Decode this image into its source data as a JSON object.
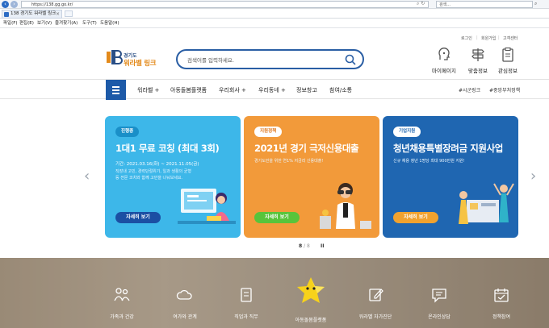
{
  "browser": {
    "url": "https://138.gg.go.kr/",
    "search_placeholder": "검색...",
    "tab_title": "138 경기도 워라벨 링크",
    "menu": [
      "파일(F)",
      "편집(E)",
      "보기(V)",
      "즐겨찾기(A)",
      "도구(T)",
      "도움말(H)"
    ]
  },
  "header": {
    "util_links": [
      "로그인",
      "회원가입",
      "고객센터"
    ],
    "logo_top": "경기도",
    "logo_bottom": "워라벨 링크",
    "search_placeholder": "검색어를 입력하세요.",
    "quick_links": [
      {
        "label": "마이페이지",
        "icon": "user-head-icon"
      },
      {
        "label": "맞춤정보",
        "icon": "signpost-icon"
      },
      {
        "label": "관심정보",
        "icon": "clipboard-icon"
      }
    ]
  },
  "gnb": {
    "items": [
      "워라벨",
      "아동돌봄플랫폼",
      "우리회사",
      "우리동네",
      "정보창고",
      "참여/소통"
    ],
    "tags": [
      "#시군링크",
      "#중앙부처정책"
    ]
  },
  "cards": [
    {
      "badge": "진행중",
      "title": "1대1 무료 코칭 (최대 3회)",
      "date": "기간: 2021.03.16(화) ~ 2021.11.05(금)",
      "desc": "직장내 고민, 경력단절위기, 일과 생활의 균형 등 전문 코치와 함께 고민을 나눠보세요.",
      "button": "자세히 보기",
      "color": "#3db7e9"
    },
    {
      "badge": "지원정책",
      "title": "2021년 경기 극저신용대출",
      "date": "",
      "desc": "경기도민을 위한 연1% 저금리 신용대출!",
      "button": "자세히 보기",
      "color": "#f29a3a"
    },
    {
      "badge": "기업지원",
      "title": "청년채용특별장려금 지원사업",
      "date": "",
      "desc": "신규 채용 청년 1명당 최대 900만원 지원!",
      "button": "자세히 보기",
      "color": "#1f66b1"
    }
  ],
  "pager": {
    "current": "8",
    "total": "/ 8",
    "pause": "II"
  },
  "services": [
    "가족과 건강",
    "여가와 관계",
    "직업과 직무",
    "아동돌봄플랫폼",
    "워라벨 자가진단",
    "온라인상담",
    "정책참여"
  ]
}
